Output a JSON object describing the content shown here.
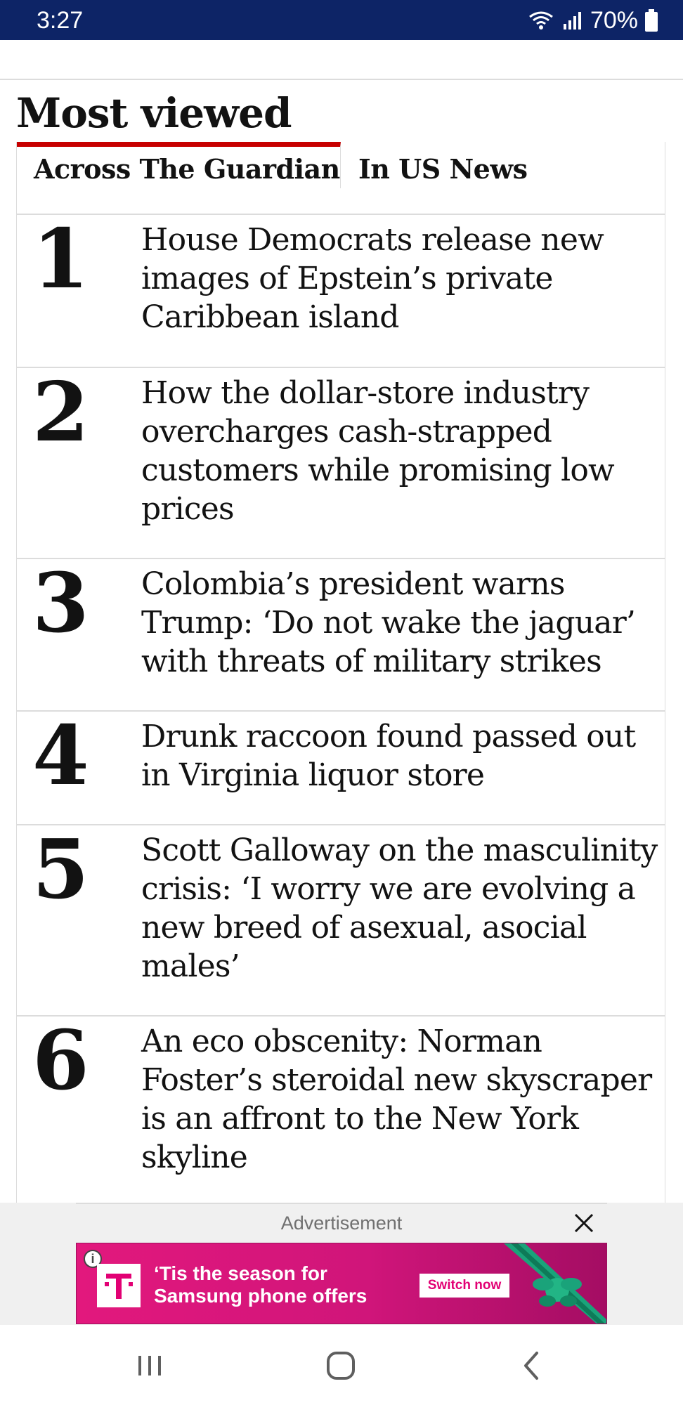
{
  "status_bar": {
    "time": "3:27",
    "battery_percent": "70%",
    "icons": [
      "wifi-icon",
      "signal-icon",
      "battery-icon"
    ]
  },
  "most_viewed": {
    "title": "Most viewed",
    "tabs": [
      {
        "label": "Across The Guardian",
        "active": true
      },
      {
        "label": "In US News",
        "active": false
      }
    ],
    "items": [
      {
        "rank": "1",
        "headline": "House Democrats release new images of Epstein’s private Caribbean island"
      },
      {
        "rank": "2",
        "headline": "How the dollar-store industry overcharges cash-strapped customers while promising low prices"
      },
      {
        "rank": "3",
        "headline": "Colombia’s president warns Trump: ‘Do not wake the jaguar’ with threats of military strikes"
      },
      {
        "rank": "4",
        "headline": "Drunk raccoon found passed out in Virginia liquor store"
      },
      {
        "rank": "5",
        "headline": "Scott Galloway on the masculinity crisis: ‘I worry we are evolving a new breed of asexual, asocial males’"
      },
      {
        "rank": "6",
        "headline": "An eco obscenity: Norman Foster’s steroidal new skyscraper is an affront to the New York skyline"
      }
    ]
  },
  "advertisement": {
    "label": "Advertisement",
    "banner_text": "‘Tis the season for\nSamsung phone offers",
    "cta": "Switch now",
    "info_glyph": "i",
    "brand_color": "#e20074"
  },
  "colors": {
    "status_bar": "#0d2466",
    "accent_red": "#c70000",
    "divider": "#dcdcdc"
  }
}
